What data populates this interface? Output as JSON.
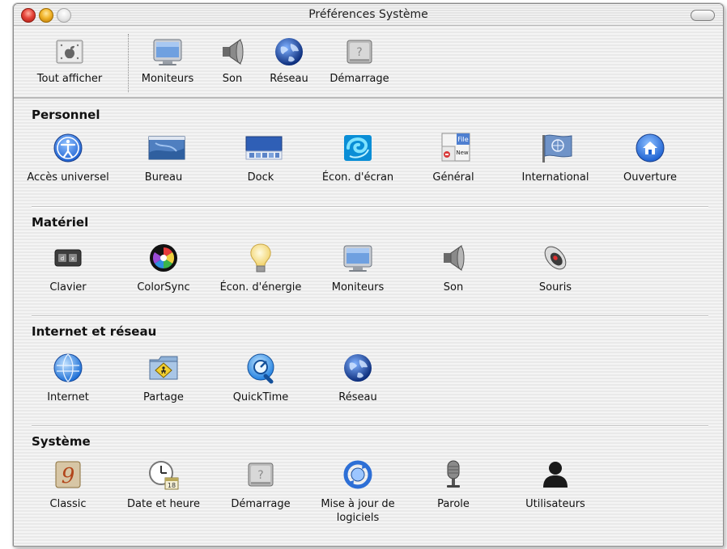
{
  "window": {
    "title": "Préférences Système"
  },
  "toolbar": {
    "items": [
      {
        "label": "Tout afficher",
        "icon": "show-all-icon"
      },
      {
        "label": "Moniteurs",
        "icon": "monitor-icon"
      },
      {
        "label": "Son",
        "icon": "speaker-icon"
      },
      {
        "label": "Réseau",
        "icon": "globe-icon"
      },
      {
        "label": "Démarrage",
        "icon": "startup-disk-icon"
      }
    ]
  },
  "sections": [
    {
      "title": "Personnel",
      "items": [
        {
          "label": "Accès universel",
          "icon": "universal-access-icon"
        },
        {
          "label": "Bureau",
          "icon": "desktop-icon"
        },
        {
          "label": "Dock",
          "icon": "dock-icon"
        },
        {
          "label": "Écon. d'écran",
          "icon": "screensaver-icon"
        },
        {
          "label": "Général",
          "icon": "general-icon"
        },
        {
          "label": "International",
          "icon": "international-flag-icon"
        },
        {
          "label": "Ouverture",
          "icon": "login-home-icon"
        }
      ]
    },
    {
      "title": "Matériel",
      "items": [
        {
          "label": "Clavier",
          "icon": "keyboard-icon"
        },
        {
          "label": "ColorSync",
          "icon": "colorsync-icon"
        },
        {
          "label": "Écon. d'énergie",
          "icon": "lightbulb-icon"
        },
        {
          "label": "Moniteurs",
          "icon": "monitor-icon"
        },
        {
          "label": "Son",
          "icon": "speaker-icon"
        },
        {
          "label": "Souris",
          "icon": "mouse-icon"
        }
      ]
    },
    {
      "title": "Internet et réseau",
      "items": [
        {
          "label": "Internet",
          "icon": "internet-globe-icon"
        },
        {
          "label": "Partage",
          "icon": "sharing-folder-icon"
        },
        {
          "label": "QuickTime",
          "icon": "quicktime-icon"
        },
        {
          "label": "Réseau",
          "icon": "globe-icon"
        }
      ]
    },
    {
      "title": "Système",
      "items": [
        {
          "label": "Classic",
          "icon": "classic-icon"
        },
        {
          "label": "Date et heure",
          "icon": "clock-calendar-icon"
        },
        {
          "label": "Démarrage",
          "icon": "startup-disk-icon"
        },
        {
          "label": "Mise à jour de logiciels",
          "icon": "software-update-icon"
        },
        {
          "label": "Parole",
          "icon": "microphone-icon"
        },
        {
          "label": "Utilisateurs",
          "icon": "user-silhouette-icon"
        }
      ]
    }
  ]
}
